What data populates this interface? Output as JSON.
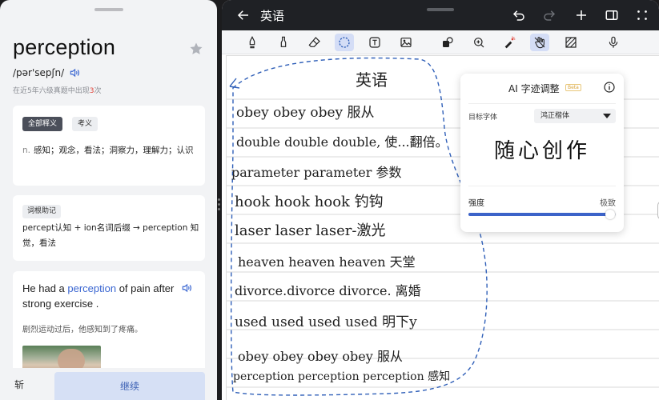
{
  "dict": {
    "word": "perception",
    "phonetic": "/pər'sepʃn/",
    "frequency_prefix": "在近5年六级真题中出现",
    "frequency_count": "3",
    "frequency_suffix": "次",
    "chips": {
      "all": "全部释义",
      "exam": "考义"
    },
    "definition_pos": "n.",
    "definition_text": "感知；观念，看法；洞察力，理解力；认识",
    "root_chip": "词根助记",
    "root_text": "percept认知 + ion名词后缀 → perception 知觉，看法",
    "example_pre": "He had a ",
    "example_hl": "perception",
    "example_post": " of pain after strong exercise .",
    "example_cn": "剧烈运动过后，他感知到了疼痛。",
    "btn_kill": "斩",
    "btn_continue": "继续"
  },
  "note": {
    "title": "英语",
    "heading": "英语",
    "lines": [
      "obey obey obey 服从",
      "double  double double, 使...翻倍。",
      "parameter parameter 参数",
      "hook hook hook   钓钩",
      "laser laser  laser-激光",
      "heaven  heaven heaven 天堂",
      "divorce.divorce divorce. 离婚",
      "used used used used  明下y",
      "obey  obey obey obey 服从",
      "perception perception  perception 感知"
    ]
  },
  "ai": {
    "title": "AI 字迹调整",
    "beta": "Beta",
    "font_label": "目标字体",
    "font_value": "鸿正楷体",
    "preview": "随心创作",
    "strength_label": "强度",
    "strength_max": "极致",
    "strength_value": 0.96
  },
  "colors": {
    "accent": "#3c63c9",
    "highlight": "#3a66d1",
    "lasso": "#2f5fb8"
  }
}
